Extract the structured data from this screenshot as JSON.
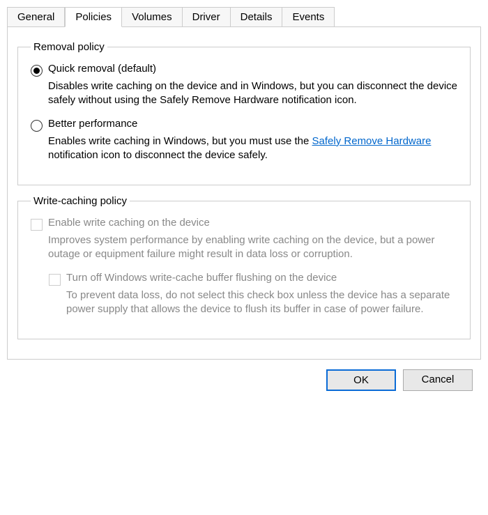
{
  "tabs": {
    "general": "General",
    "policies": "Policies",
    "volumes": "Volumes",
    "driver": "Driver",
    "details": "Details",
    "events": "Events"
  },
  "removal": {
    "legend": "Removal policy",
    "quick": {
      "label": "Quick removal (default)",
      "desc": "Disables write caching on the device and in Windows, but you can disconnect the device safely without using the Safely Remove Hardware notification icon."
    },
    "better": {
      "label": "Better performance",
      "desc_prefix": "Enables write caching in Windows, but you must use the ",
      "link": "Safely Remove Hardware",
      "desc_suffix": " notification icon to disconnect the device safely."
    }
  },
  "writecache": {
    "legend": "Write-caching policy",
    "enable": {
      "label": "Enable write caching on the device",
      "desc": "Improves system performance by enabling write caching on the device, but a power outage or equipment failure might result in data loss or corruption."
    },
    "flush": {
      "label": "Turn off Windows write-cache buffer flushing on the device",
      "desc": "To prevent data loss, do not select this check box unless the device has a separate power supply that allows the device to flush its buffer in case of power failure."
    }
  },
  "buttons": {
    "ok": "OK",
    "cancel": "Cancel"
  }
}
